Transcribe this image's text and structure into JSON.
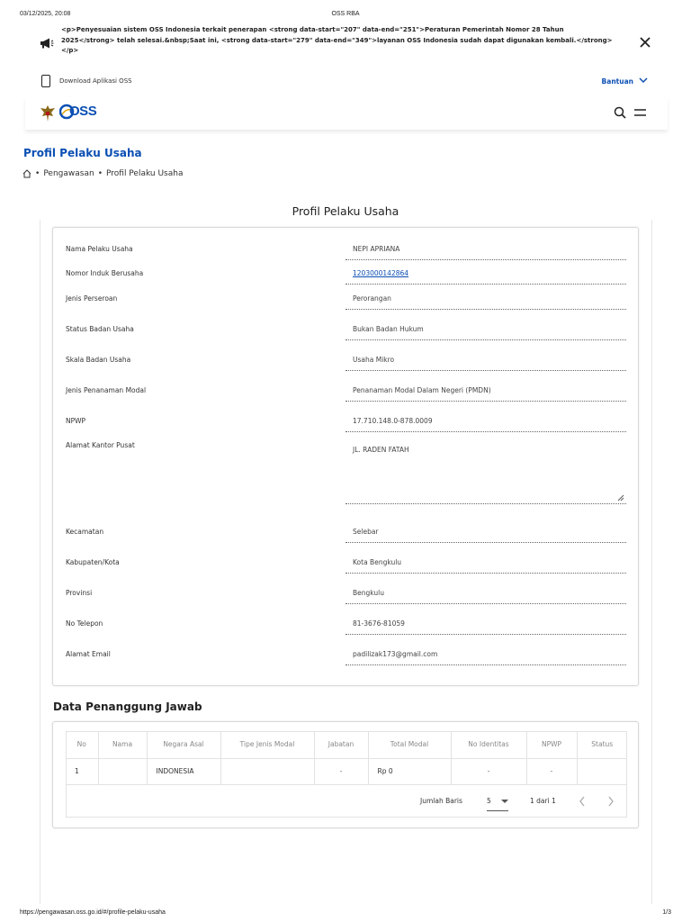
{
  "print": {
    "datetime": "03/12/2025, 20:08",
    "title": "OSS RBA",
    "url": "https://pengawasan.oss.go.id/#/profile-pelaku-usaha",
    "page": "1/3"
  },
  "announcement": {
    "text": "<p>Penyesuaian sistem OSS Indonesia terkait penerapan <strong data-start=\"207\" data-end=\"251\">Peraturan Pemerintah Nomor 28 Tahun 2025</strong> telah selesai.&nbsp;Saat ini, <strong data-start=\"279\" data-end=\"349\">layanan OSS Indonesia sudah dapat digunakan kembali.</strong></p>",
    "icon": "megaphone-icon"
  },
  "topbar": {
    "download_label": "Download Aplikasi OSS",
    "help_label": "Bantuan"
  },
  "navbar": {
    "logo_text": "OSS"
  },
  "page": {
    "title": "Profil Pelaku Usaha",
    "breadcrumb": [
      "Pengawasan",
      "Profil Pelaku Usaha"
    ],
    "section_title": "Profil Pelaku Usaha"
  },
  "profile": {
    "fields": [
      {
        "label": "Nama Pelaku Usaha",
        "value": "NEPI APRIANA"
      },
      {
        "label": "Nomor Induk Berusaha",
        "value": "1203000142864"
      },
      {
        "label": "Jenis Perseroan",
        "value": "Perorangan"
      },
      {
        "label": "Status Badan Usaha",
        "value": "Bukan Badan Hukum"
      },
      {
        "label": "Skala Badan Usaha",
        "value": "Usaha Mikro"
      },
      {
        "label": "Jenis Penanaman Modal",
        "value": "Penanaman Modal Dalam Negeri (PMDN)"
      },
      {
        "label": "NPWP",
        "value": "17.710.148.0-878.0009"
      },
      {
        "label": "Alamat Kantor Pusat",
        "value": "JL. RADEN FATAH"
      },
      {
        "label": "Kecamatan",
        "value": "Selebar"
      },
      {
        "label": "Kabupaten/Kota",
        "value": "Kota Bengkulu"
      },
      {
        "label": "Provinsi",
        "value": "Bengkulu"
      },
      {
        "label": "No Telepon",
        "value": "81-3676-81059"
      },
      {
        "label": "Alamat Email",
        "value": "padilizak173@gmail.com"
      }
    ]
  },
  "penanggung_jawab": {
    "title": "Data Penanggung Jawab",
    "columns": [
      "No",
      "Nama",
      "Negara Asal",
      "Tipe Jenis Modal",
      "Jabatan",
      "Total Modal",
      "No Identitas",
      "NPWP",
      "Status"
    ],
    "rows": [
      [
        "1",
        "",
        "INDONESIA",
        "",
        "-",
        "Rp 0",
        "-",
        "-",
        ""
      ]
    ],
    "pager": {
      "rows_label": "Jumlah Baris",
      "rows_value": "5",
      "range": "1 dari 1"
    }
  }
}
